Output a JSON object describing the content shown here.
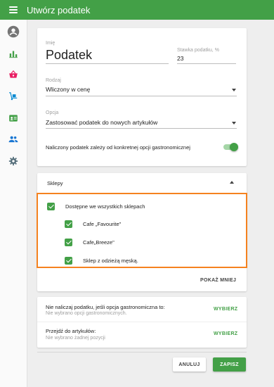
{
  "header": {
    "title": "Utwórz podatek"
  },
  "sidebar": {
    "items": [
      {
        "icon": "account-circle-icon"
      },
      {
        "icon": "bar-chart-icon"
      },
      {
        "icon": "basket-icon"
      },
      {
        "icon": "dolly-icon"
      },
      {
        "icon": "id-card-icon"
      },
      {
        "icon": "people-icon"
      },
      {
        "icon": "gear-icon"
      }
    ]
  },
  "form": {
    "name_label": "Imię",
    "name_value": "Podatek",
    "rate_label": "Stawka podatku, %",
    "rate_value": "23",
    "type_label": "Rodzaj",
    "type_value": "Wliczony w cenę",
    "option_label": "Opcja",
    "option_value": "Zastosować podatek do nowych artykułów",
    "toggle_label": "Naliczony podatek zależy od konkretnej opcji gastronomicznej",
    "toggle_on": true
  },
  "stores": {
    "title": "Sklepy",
    "all_label": "Dostępne we wszystkich sklepach",
    "items": [
      {
        "label": "Cafe „Favourite\"",
        "checked": true
      },
      {
        "label": "Cafe„Breeze\"",
        "checked": true
      },
      {
        "label": "Sklep z odzieżą męską.",
        "checked": true
      }
    ],
    "show_less": "POKAŻ MNIEJ"
  },
  "exclusions": {
    "no_tax_title": "Nie naliczaj podatku, jeśli opcja gastronomiczna to:",
    "no_tax_sub": "Nie wybrano opcji gastronomicznych.",
    "no_tax_action": "WYBIERZ",
    "goto_title": "Przejdź do artykułów:",
    "goto_sub": "Nie wybrano żadnej pozycji",
    "goto_action": "WYBIERZ"
  },
  "actions": {
    "cancel": "ANULUJ",
    "save": "ZAPISZ"
  },
  "colors": {
    "primary": "#43a047",
    "highlight": "#f5821f"
  }
}
